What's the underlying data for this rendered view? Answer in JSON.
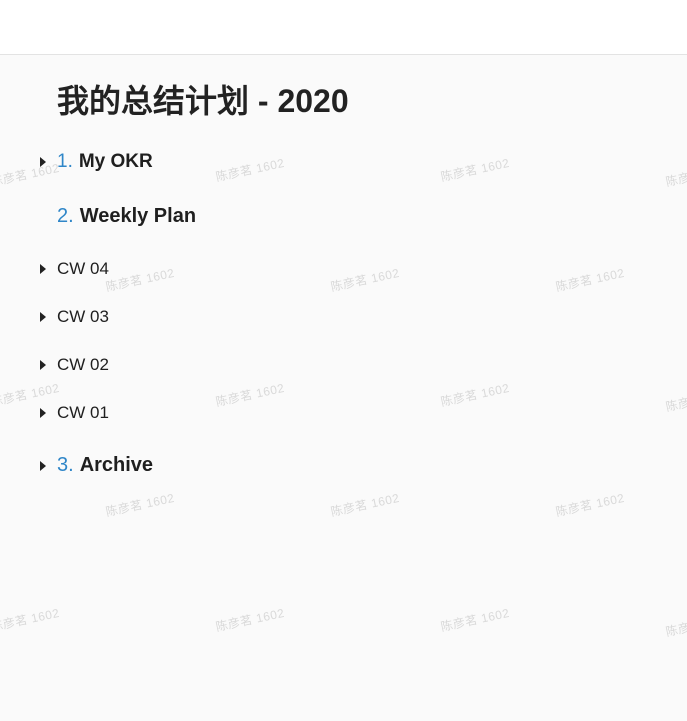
{
  "page": {
    "title": "我的总结计划 - 2020"
  },
  "watermark": {
    "text": "陈彦茗 1602"
  },
  "outline": {
    "sections": [
      {
        "number": "1.",
        "label": "My OKR",
        "collapsed": true
      },
      {
        "number": "2.",
        "label": "Weekly Plan",
        "collapsed": false
      },
      {
        "number": "3.",
        "label": "Archive",
        "collapsed": true
      }
    ],
    "weekly_items": [
      {
        "label": "CW 04",
        "collapsed": true
      },
      {
        "label": "CW 03",
        "collapsed": true
      },
      {
        "label": "CW 02",
        "collapsed": true
      },
      {
        "label": "CW 01",
        "collapsed": true
      }
    ]
  },
  "icons": {
    "collapsed": "caret-right-icon"
  }
}
